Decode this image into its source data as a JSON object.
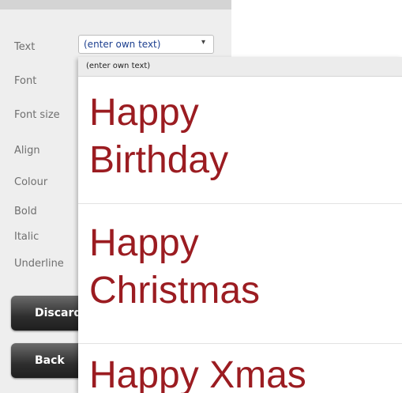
{
  "form": {
    "labels": {
      "text": "Text",
      "font": "Font",
      "font_size": "Font size",
      "align": "Align",
      "colour": "Colour",
      "bold": "Bold",
      "italic": "Italic",
      "underline": "Underline"
    },
    "text_select_value": "(enter own text)",
    "arrow_icon": "▾"
  },
  "buttons": {
    "discard": "Discard",
    "back": "Back"
  },
  "dropdown": {
    "header": "(enter own text)",
    "options": [
      {
        "line1": "Happy",
        "line2": "Birthday"
      },
      {
        "line1": "Happy",
        "line2": "Christmas"
      },
      {
        "line1": "Happy Xmas"
      }
    ],
    "text_color": "#9b1c21"
  }
}
